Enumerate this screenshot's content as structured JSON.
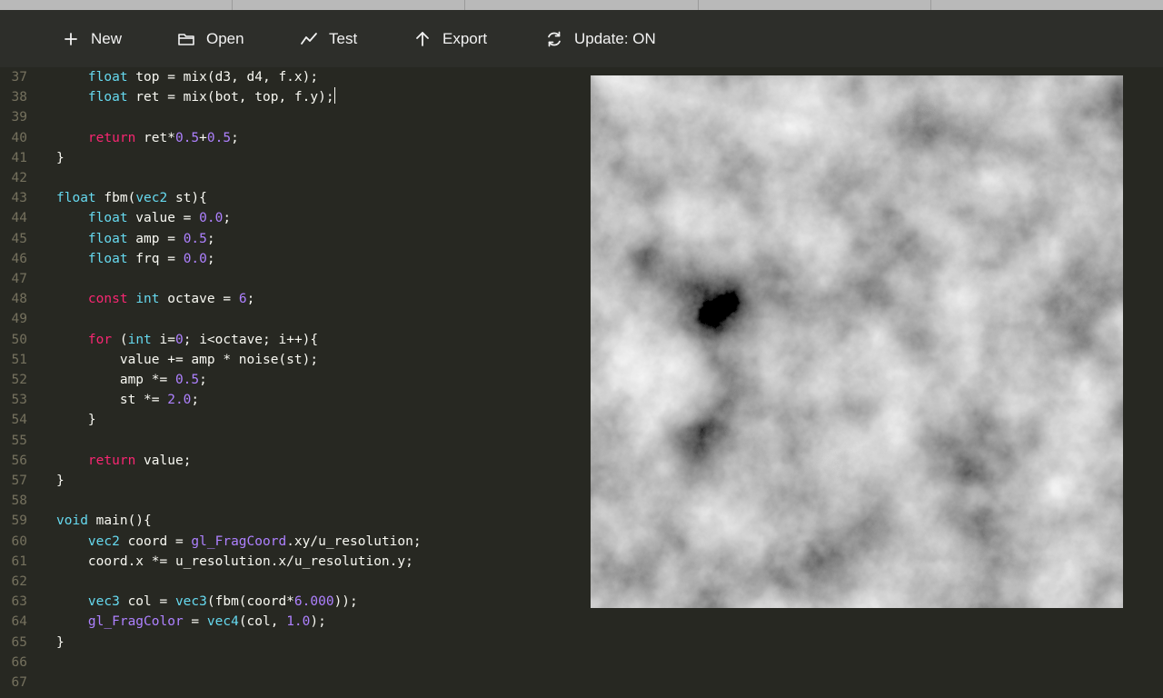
{
  "toolbar": {
    "new_label": "New",
    "open_label": "Open",
    "test_label": "Test",
    "export_label": "Export",
    "update_label": "Update: ON"
  },
  "editor": {
    "lines": [
      {
        "n": "37",
        "tokens": [
          [
            "t",
            "    "
          ],
          [
            "kt",
            "float"
          ],
          [
            "t",
            " top = mix(d3, d4, f.x);"
          ]
        ]
      },
      {
        "n": "38",
        "tokens": [
          [
            "t",
            "    "
          ],
          [
            "kt",
            "float"
          ],
          [
            "t",
            " ret = mix(bot, top, f.y);"
          ]
        ],
        "cursor": true
      },
      {
        "n": "39",
        "tokens": []
      },
      {
        "n": "40",
        "tokens": [
          [
            "t",
            "    "
          ],
          [
            "kc",
            "return"
          ],
          [
            "t",
            " ret*"
          ],
          [
            "num",
            "0.5"
          ],
          [
            "t",
            "+"
          ],
          [
            "num",
            "0.5"
          ],
          [
            "t",
            ";"
          ]
        ]
      },
      {
        "n": "41",
        "tokens": [
          [
            "t",
            "}"
          ]
        ]
      },
      {
        "n": "42",
        "tokens": []
      },
      {
        "n": "43",
        "tokens": [
          [
            "kt",
            "float"
          ],
          [
            "t",
            " fbm("
          ],
          [
            "kt",
            "vec2"
          ],
          [
            "t",
            " st){"
          ]
        ]
      },
      {
        "n": "44",
        "tokens": [
          [
            "t",
            "    "
          ],
          [
            "kt",
            "float"
          ],
          [
            "t",
            " value = "
          ],
          [
            "num",
            "0.0"
          ],
          [
            "t",
            ";"
          ]
        ]
      },
      {
        "n": "45",
        "tokens": [
          [
            "t",
            "    "
          ],
          [
            "kt",
            "float"
          ],
          [
            "t",
            " amp = "
          ],
          [
            "num",
            "0.5"
          ],
          [
            "t",
            ";"
          ]
        ]
      },
      {
        "n": "46",
        "tokens": [
          [
            "t",
            "    "
          ],
          [
            "kt",
            "float"
          ],
          [
            "t",
            " frq = "
          ],
          [
            "num",
            "0.0"
          ],
          [
            "t",
            ";"
          ]
        ]
      },
      {
        "n": "47",
        "tokens": []
      },
      {
        "n": "48",
        "tokens": [
          [
            "t",
            "    "
          ],
          [
            "kc",
            "const"
          ],
          [
            "t",
            " "
          ],
          [
            "kt",
            "int"
          ],
          [
            "t",
            " octave = "
          ],
          [
            "num",
            "6"
          ],
          [
            "t",
            ";"
          ]
        ]
      },
      {
        "n": "49",
        "tokens": []
      },
      {
        "n": "50",
        "tokens": [
          [
            "t",
            "    "
          ],
          [
            "kc",
            "for"
          ],
          [
            "t",
            " ("
          ],
          [
            "kt",
            "int"
          ],
          [
            "t",
            " i="
          ],
          [
            "num",
            "0"
          ],
          [
            "t",
            "; i<octave; i++){"
          ]
        ]
      },
      {
        "n": "51",
        "tokens": [
          [
            "t",
            "        value += amp * noise(st);"
          ]
        ]
      },
      {
        "n": "52",
        "tokens": [
          [
            "t",
            "        amp *= "
          ],
          [
            "num",
            "0.5"
          ],
          [
            "t",
            ";"
          ]
        ]
      },
      {
        "n": "53",
        "tokens": [
          [
            "t",
            "        st *= "
          ],
          [
            "num",
            "2.0"
          ],
          [
            "t",
            ";"
          ]
        ]
      },
      {
        "n": "54",
        "tokens": [
          [
            "t",
            "    }"
          ]
        ]
      },
      {
        "n": "55",
        "tokens": []
      },
      {
        "n": "56",
        "tokens": [
          [
            "t",
            "    "
          ],
          [
            "kc",
            "return"
          ],
          [
            "t",
            " value;"
          ]
        ]
      },
      {
        "n": "57",
        "tokens": [
          [
            "t",
            "}"
          ]
        ]
      },
      {
        "n": "58",
        "tokens": []
      },
      {
        "n": "59",
        "tokens": [
          [
            "kt",
            "void"
          ],
          [
            "t",
            " main(){"
          ]
        ]
      },
      {
        "n": "60",
        "tokens": [
          [
            "t",
            "    "
          ],
          [
            "kt",
            "vec2"
          ],
          [
            "t",
            " coord = "
          ],
          [
            "bi",
            "gl_FragCoord"
          ],
          [
            "t",
            ".xy/u_resolution;"
          ]
        ]
      },
      {
        "n": "61",
        "tokens": [
          [
            "t",
            "    coord.x *= u_resolution.x/u_resolution.y;"
          ]
        ]
      },
      {
        "n": "62",
        "tokens": []
      },
      {
        "n": "63",
        "tokens": [
          [
            "t",
            "    "
          ],
          [
            "kt",
            "vec3"
          ],
          [
            "t",
            " col = "
          ],
          [
            "kt",
            "vec3"
          ],
          [
            "t",
            "(fbm(coord*"
          ],
          [
            "num",
            "6.000"
          ],
          [
            "t",
            "));"
          ]
        ]
      },
      {
        "n": "64",
        "tokens": [
          [
            "t",
            "    "
          ],
          [
            "bi",
            "gl_FragColor"
          ],
          [
            "t",
            " = "
          ],
          [
            "kt",
            "vec4"
          ],
          [
            "t",
            "(col, "
          ],
          [
            "num",
            "1.0"
          ],
          [
            "t",
            ");"
          ]
        ]
      },
      {
        "n": "65",
        "tokens": [
          [
            "t",
            "}"
          ]
        ]
      },
      {
        "n": "66",
        "tokens": []
      },
      {
        "n": "67",
        "tokens": []
      }
    ]
  },
  "colors": {
    "background": "#272822",
    "toolbar": "#2d2e2a",
    "keyword_type": "#66d9ef",
    "keyword_control": "#f92672",
    "number": "#ae81ff",
    "text": "#f8f8f2",
    "line_number": "#75715e"
  },
  "icons": {
    "new": "plus-icon",
    "open": "folder-icon",
    "test": "chart-line-icon",
    "export": "arrow-up-icon",
    "update": "refresh-icon"
  }
}
